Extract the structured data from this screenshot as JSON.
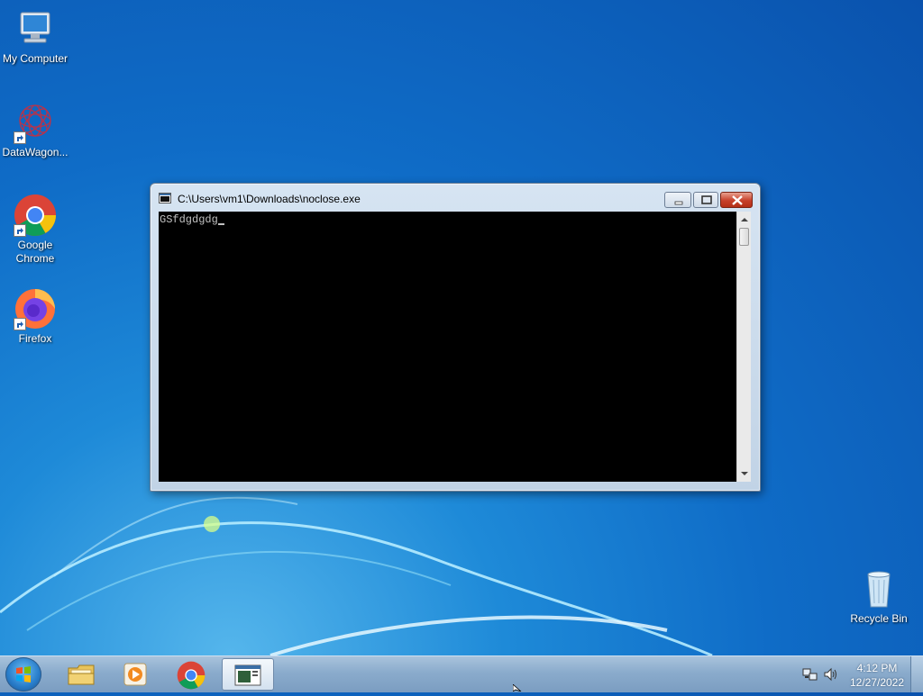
{
  "desktop": {
    "icons": [
      {
        "label": "My Computer",
        "icon": "computer-icon"
      },
      {
        "label": "DataWagon...",
        "icon": "datawagon-icon"
      },
      {
        "label": "Google Chrome",
        "icon": "chrome-icon"
      },
      {
        "label": "Firefox",
        "icon": "firefox-icon"
      },
      {
        "label": "Recycle Bin",
        "icon": "recycle-bin-icon"
      }
    ]
  },
  "window": {
    "title": "C:\\Users\\vm1\\Downloads\\noclose.exe",
    "console_text": "GSfdgdgdg",
    "buttons": {
      "minimize": "minimize-icon",
      "maximize": "maximize-icon",
      "close": "close-icon"
    }
  },
  "taskbar": {
    "items": [
      "start-orb-icon",
      "explorer-icon",
      "media-player-icon",
      "chrome-icon",
      "console-window-icon"
    ],
    "tray": [
      "network-icon",
      "volume-icon"
    ],
    "clock": {
      "time": "4:12 PM",
      "date": "12/27/2022"
    }
  },
  "colors": {
    "desktop": "#0f6cc7",
    "console_bg": "#000000",
    "console_fg": "#c0c0c0",
    "close_button": "#c7402a"
  }
}
